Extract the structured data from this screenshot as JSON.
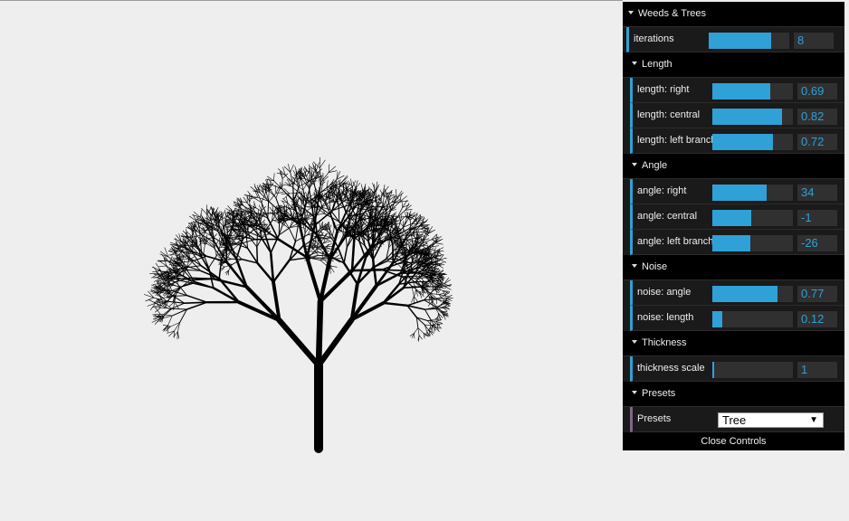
{
  "gui": {
    "root_title": "Weeds & Trees",
    "iterations": {
      "label": "iterations",
      "value": "8",
      "fill": 0.78
    },
    "folders": [
      {
        "title": "Length",
        "controls": [
          {
            "label": "length: right",
            "value": "0.69",
            "fill": 0.72
          },
          {
            "label": "length: central",
            "value": "0.82",
            "fill": 0.86
          },
          {
            "label": "length: left branch",
            "value": "0.72",
            "fill": 0.75
          }
        ]
      },
      {
        "title": "Angle",
        "controls": [
          {
            "label": "angle: right",
            "value": "34",
            "fill": 0.67
          },
          {
            "label": "angle: central",
            "value": "-1",
            "fill": 0.48
          },
          {
            "label": "angle: left branch",
            "value": "-26",
            "fill": 0.47
          }
        ]
      },
      {
        "title": "Noise",
        "controls": [
          {
            "label": "noise: angle",
            "value": "0.77",
            "fill": 0.81
          },
          {
            "label": "noise: length",
            "value": "0.12",
            "fill": 0.12
          }
        ]
      },
      {
        "title": "Thickness",
        "controls": [
          {
            "label": "thickness scale",
            "value": "1",
            "fill": 0.02
          }
        ]
      }
    ],
    "presets": {
      "title": "Presets",
      "label": "Presets",
      "selected": "Tree"
    },
    "close_label": "Close Controls"
  },
  "colors": {
    "slider_fill": "#2fa1d6",
    "background": "#eeeeee",
    "panel": "#1a1a1a"
  }
}
